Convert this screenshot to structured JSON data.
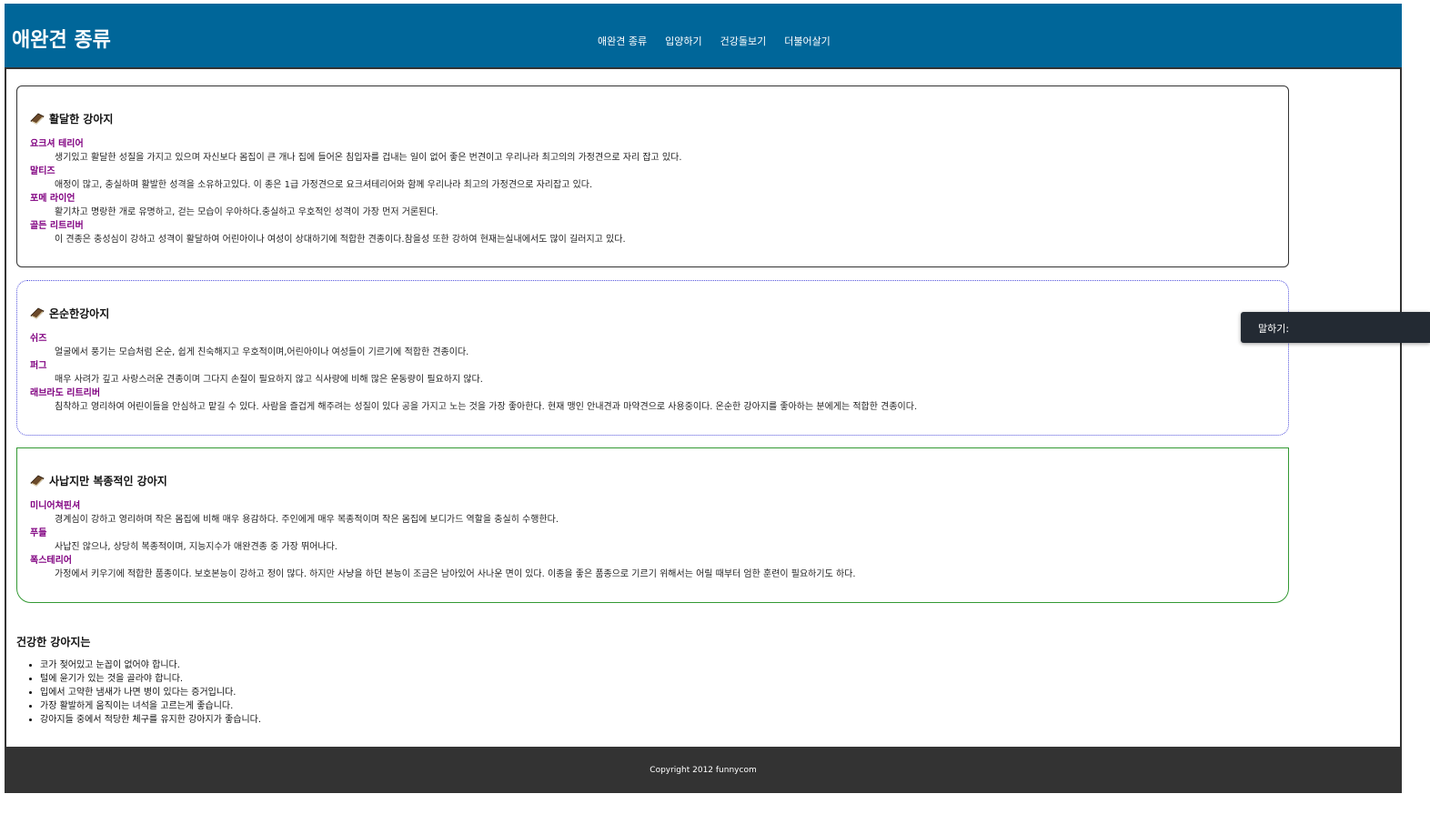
{
  "header": {
    "title": "애완견 종류",
    "nav": [
      "애완견 종류",
      "입양하기",
      "건강돌보기",
      "더불어살기"
    ]
  },
  "sections": [
    {
      "heading": "활달한 강아지",
      "breeds": [
        {
          "name": "요크셔 테리어",
          "desc": "생기있고 활달한 성질을 가지고 있으며 자신보다 몸집이 큰 개나 집에 들어온 침입자를 겁내는 일이 없어 좋은 번견이고 우리나라 최고의의 가정견으로 자리 잡고 있다."
        },
        {
          "name": "말티즈",
          "desc": "애정이 많고, 충실하며 활발한 성격을 소유하고있다. 이 종은 1급 가정견으로 요크셔테리어와 함께 우리나라 최고의 가정견으로 자리잡고 있다."
        },
        {
          "name": "포메 라이언",
          "desc": "활기차고 명랑한 개로 유명하고, 걷는 모습이 우아하다.충실하고 우호적인 성격이 가장 먼저 거론된다."
        },
        {
          "name": "골든 리트리버",
          "desc": "이 견종은 충성심이 강하고 성격이 활달하여 어린아이나 여성이 상대하기에 적합한 견종이다.참을성 또한 강하여 현재는실내에서도 많이 길러지고 있다."
        }
      ]
    },
    {
      "heading": "온순한강아지",
      "breeds": [
        {
          "name": "쉬즈",
          "desc": "얼굴에서 풍기는 모습처럼 온순, 쉽게 친숙해지고 우호적이며,어린아이나 여성들이 기르기에 적합한 견종이다."
        },
        {
          "name": "퍼그",
          "desc": "매우 사려가 깊고 사랑스러운 견종이며 그다지 손질이 필요하지 않고 식사량에 비해 많은 운동량이 필요하지 않다."
        },
        {
          "name": "래브라도 리트리버",
          "desc": "침착하고 영리하여 어린이들을 안심하고 맡길 수 있다. 사람을 즐겁게 해주려는 성질이 있다 공을 가지고 노는 것을 가장 좋아한다. 현재 맹인 안내견과 마약견으로 사용중이다. 온순한 강아지를 좋아하는 분에게는 적합한 견종이다."
        }
      ]
    },
    {
      "heading": "사납지만 복종적인 강아지",
      "breeds": [
        {
          "name": "미니어쳐핀셔",
          "desc": "경계심이 강하고 영리하며 작은 몸집에 비해 매우 용감하다. 주인에게 매우 복종적이며 작은 몸집에 보디가드 역할을 충실히 수행한다."
        },
        {
          "name": "푸들",
          "desc": "사납진 않으나, 상당히 복종적이며, 지능지수가 애완견종 중 가장 뛰어나다."
        },
        {
          "name": "폭스테리어",
          "desc": "가정에서 키우기에 적합한 품종이다. 보호본능이 강하고 정이 많다. 하지만 사냥을 하던 본능이 조금은 남아있어 사나운 면이 있다. 이종을 좋은 품종으로 기르기 위해서는 어릴 때부터 엄한 훈련이 필요하기도 하다."
        }
      ]
    }
  ],
  "health": {
    "heading": "건강한 강아지는",
    "items": [
      "코가 젖어있고 눈꼽이 없어야 합니다.",
      "털에 윤기가 있는 것을 골라야 합니다.",
      "입에서 고약한 냄새가 나면 병이 있다는 증거입니다.",
      "가장 활발하게 움직이는 녀석을 고르는게 좋습니다.",
      "강아지들 중에서 적당한 체구를 유지한 강아지가 좋습니다."
    ]
  },
  "footer": {
    "copyright": "Copyright 2012 funnycom"
  },
  "speak_panel": {
    "label": "말하기:"
  },
  "icons": {
    "section_icon": "book-icon"
  },
  "colors": {
    "header_bg": "#006699",
    "breed_name": "#800080",
    "footer_bg": "#333333"
  }
}
